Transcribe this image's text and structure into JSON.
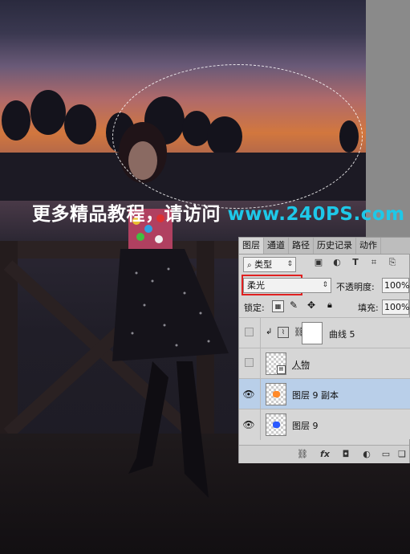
{
  "watermark": {
    "chinese": "更多精品教程，请访问",
    "url": "www.240PS.com"
  },
  "panel": {
    "tabs": [
      "图层",
      "通道",
      "路径",
      "历史记录",
      "动作"
    ],
    "filter": {
      "icon": "search-icon",
      "label": "类型"
    },
    "filter_icons": [
      "image-filter-icon",
      "adjustment-filter-icon",
      "type-filter-icon",
      "shape-filter-icon",
      "smart-object-filter-icon"
    ],
    "blend_mode": "柔光",
    "opacity_label": "不透明度:",
    "opacity_value": "100%",
    "lock_label": "锁定:",
    "fill_label": "填充:",
    "fill_value": "100%",
    "layers": [
      {
        "name": "曲线 5",
        "visible": false,
        "type": "curves-adjustment"
      },
      {
        "name": "人物",
        "visible": false,
        "type": "smart-object"
      },
      {
        "name": "图层 9 副本",
        "visible": true,
        "selected": true,
        "thumb_color": "#ff8a2a"
      },
      {
        "name": "图层 9",
        "visible": true,
        "thumb_color": "#2a5aff"
      }
    ],
    "bottom_icons": [
      "link-icon",
      "fx-icon",
      "mask-icon",
      "adjustment-layer-icon",
      "folder-icon",
      "new-layer-icon"
    ],
    "fx_label": "fx"
  },
  "colors": {
    "selection_red": "#e02020",
    "url_cyan": "#1ec8e8",
    "selected_layer": "#b9cfe9"
  }
}
